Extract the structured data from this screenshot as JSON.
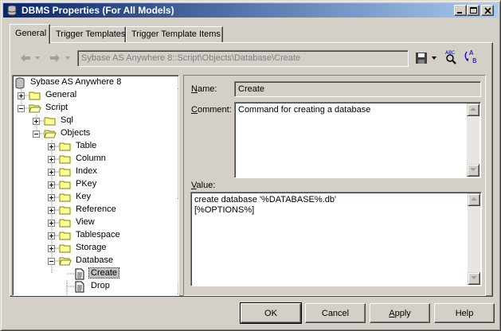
{
  "window": {
    "title": "DBMS Properties (For All Models)",
    "icon": "database-icon"
  },
  "title_buttons": {
    "minimize": "minimize-icon",
    "maximize": "maximize-icon",
    "close": "close-icon"
  },
  "tabs": [
    {
      "label": "General",
      "active": true
    },
    {
      "label": "Trigger Templates",
      "active": false
    },
    {
      "label": "Trigger Template Items",
      "active": false
    }
  ],
  "toolbar": {
    "back_icon": "back-arrow-icon",
    "forward_icon": "forward-arrow-icon",
    "path": "Sybase AS Anywhere 8::Script\\Objects\\Database\\Create",
    "save_icon": "save-disk-icon",
    "find_icon": "find-icon",
    "replace_icon": "replace-icon"
  },
  "tree": {
    "root": "Sybase AS Anywhere 8",
    "items": [
      {
        "label": "General",
        "icon": "folder-icon",
        "expander": "plus"
      },
      {
        "label": "Script",
        "icon": "folder-open-icon",
        "expander": "minus"
      },
      {
        "label": "Sql",
        "icon": "folder-icon",
        "expander": "plus"
      },
      {
        "label": "Objects",
        "icon": "folder-open-icon",
        "expander": "minus"
      },
      {
        "label": "Table",
        "icon": "folder-icon",
        "expander": "plus"
      },
      {
        "label": "Column",
        "icon": "folder-icon",
        "expander": "plus"
      },
      {
        "label": "Index",
        "icon": "folder-icon",
        "expander": "plus"
      },
      {
        "label": "PKey",
        "icon": "folder-icon",
        "expander": "plus"
      },
      {
        "label": "Key",
        "icon": "folder-icon",
        "expander": "plus"
      },
      {
        "label": "Reference",
        "icon": "folder-icon",
        "expander": "plus"
      },
      {
        "label": "View",
        "icon": "folder-icon",
        "expander": "plus"
      },
      {
        "label": "Tablespace",
        "icon": "folder-icon",
        "expander": "plus"
      },
      {
        "label": "Storage",
        "icon": "folder-icon",
        "expander": "plus"
      },
      {
        "label": "Database",
        "icon": "folder-open-icon",
        "expander": "minus"
      },
      {
        "label": "Create",
        "icon": "document-icon",
        "selected": true
      },
      {
        "label": "Drop",
        "icon": "document-icon"
      }
    ]
  },
  "fields": {
    "name_label": "Name:",
    "name_value": "Create",
    "comment_label": "Comment:",
    "comment_value": "Command for creating a database",
    "value_label": "Value:",
    "value_lines": [
      "create database '%DATABASE%.db'",
      "[%OPTIONS%]"
    ]
  },
  "buttons": {
    "ok": "OK",
    "cancel": "Cancel",
    "apply": "Apply",
    "help": "Help"
  },
  "colors": {
    "face": "#d4d0c8",
    "title_start": "#0a246a",
    "title_end": "#a6caf0",
    "folder": "#ffff99"
  }
}
